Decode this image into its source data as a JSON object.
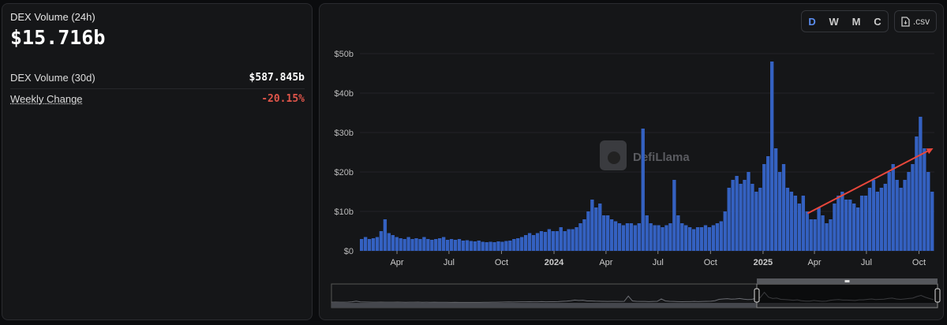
{
  "summary": {
    "title": "DEX Volume (24h)",
    "value": "$15.716b",
    "rows": [
      {
        "label": "DEX Volume (30d)",
        "value": "$587.845b"
      },
      {
        "label": "Weekly Change",
        "value": "-20.15%"
      }
    ]
  },
  "toolbar": {
    "periods": [
      "D",
      "W",
      "M",
      "C"
    ],
    "active": "D",
    "csv_label": ".csv"
  },
  "watermark": "DefiLlama",
  "colors": {
    "bar": "#3461c1",
    "negative": "#e0554a",
    "active": "#5b8def",
    "arrow": "#e8473b"
  },
  "chart_data": {
    "type": "bar",
    "title": "DEX Volume",
    "x_start": "2023-01-26",
    "x_end": "2025-10-28",
    "ylim": [
      0,
      52
    ],
    "y_ticks": [
      {
        "v": 0,
        "label": "$0"
      },
      {
        "v": 10,
        "label": "$10b"
      },
      {
        "v": 20,
        "label": "$20b"
      },
      {
        "v": 30,
        "label": "$30b"
      },
      {
        "v": 40,
        "label": "$40b"
      },
      {
        "v": 50,
        "label": "$50b"
      }
    ],
    "x_ticks": [
      {
        "d": "2023-04-01",
        "label": "Apr"
      },
      {
        "d": "2023-07-01",
        "label": "Jul"
      },
      {
        "d": "2023-10-01",
        "label": "Oct"
      },
      {
        "d": "2024-01-01",
        "label": "2024",
        "bold": true
      },
      {
        "d": "2024-04-01",
        "label": "Apr"
      },
      {
        "d": "2024-07-01",
        "label": "Jul"
      },
      {
        "d": "2024-10-01",
        "label": "Oct"
      },
      {
        "d": "2025-01-01",
        "label": "2025",
        "bold": true
      },
      {
        "d": "2025-04-01",
        "label": "Apr"
      },
      {
        "d": "2025-07-01",
        "label": "Jul"
      },
      {
        "d": "2025-10-01",
        "label": "Oct"
      }
    ],
    "values_unit": "$b (approx. weekly)",
    "values": [
      3,
      3.5,
      3,
      3.2,
      3.5,
      5,
      8,
      4.5,
      4,
      3.5,
      3.2,
      3,
      3.5,
      3,
      3.2,
      3,
      3.5,
      3,
      2.8,
      3,
      3.2,
      3.5,
      2.8,
      3,
      2.8,
      3,
      2.6,
      2.7,
      2.5,
      2.4,
      2.6,
      2.3,
      2.2,
      2.3,
      2.2,
      2.4,
      2.3,
      2.5,
      2.6,
      3,
      3.2,
      3.5,
      4,
      4.5,
      4,
      4.5,
      5,
      4.8,
      5.5,
      5,
      5,
      6,
      5,
      5.5,
      5.5,
      6,
      7,
      8,
      10,
      13,
      11,
      12,
      9,
      9,
      8,
      7.5,
      7,
      6.5,
      7,
      7,
      6.5,
      7,
      31,
      9,
      7,
      6.5,
      6.5,
      6,
      6.5,
      7,
      18,
      9,
      7,
      6.5,
      6,
      5.5,
      6,
      6,
      6.5,
      6,
      6.5,
      7,
      7.5,
      10,
      16,
      18,
      19,
      17,
      18,
      20,
      17,
      15,
      16,
      22,
      24,
      48,
      26,
      20,
      22,
      16,
      15,
      14,
      12,
      14,
      10,
      8,
      8,
      11,
      9,
      7,
      8,
      12,
      14,
      15,
      13,
      13,
      12,
      11,
      14,
      14,
      16,
      18,
      15,
      16,
      17,
      20,
      22,
      18,
      16,
      18,
      20,
      22,
      29,
      34,
      26,
      20,
      15
    ],
    "annotation": {
      "type": "trend-arrow",
      "from": {
        "d": "2025-03-20",
        "v": 9.5
      },
      "to": {
        "d": "2025-10-26",
        "v": 26
      }
    },
    "navigator": {
      "selected_from": "2025-01-01",
      "selected_to": "2025-10-28"
    }
  }
}
